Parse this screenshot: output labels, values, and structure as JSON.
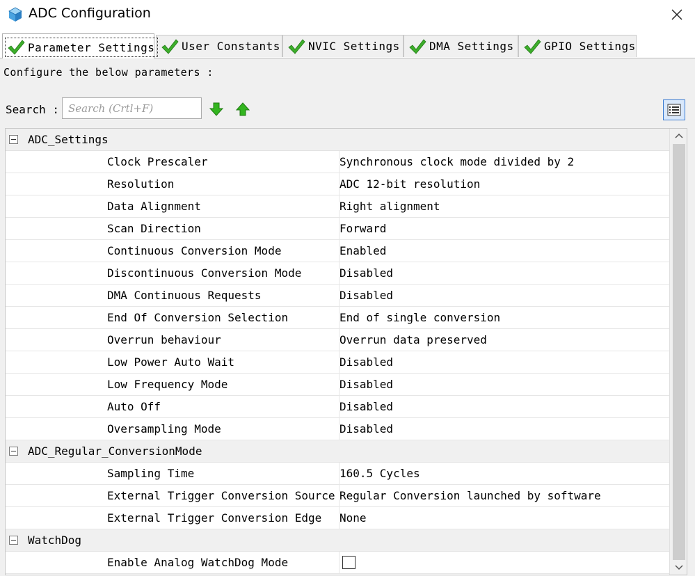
{
  "window": {
    "title": "ADC Configuration",
    "close_glyph": "✕"
  },
  "tabs": [
    {
      "label": "Parameter Settings",
      "active": true
    },
    {
      "label": "User Constants",
      "active": false
    },
    {
      "label": "NVIC Settings",
      "active": false
    },
    {
      "label": "DMA Settings",
      "active": false
    },
    {
      "label": "GPIO Settings",
      "active": false
    }
  ],
  "intro_text": "Configure the below parameters :",
  "search": {
    "label": "Search :",
    "placeholder": "Search (Crtl+F)"
  },
  "groups": {
    "adc_settings": {
      "label": "ADC_Settings",
      "params": [
        {
          "name": "Clock Prescaler",
          "value": "Synchronous clock mode divided by 2"
        },
        {
          "name": "Resolution",
          "value": "ADC 12-bit resolution"
        },
        {
          "name": "Data Alignment",
          "value": "Right alignment"
        },
        {
          "name": "Scan Direction",
          "value": "Forward"
        },
        {
          "name": "Continuous Conversion Mode",
          "value": "Enabled"
        },
        {
          "name": "Discontinuous Conversion Mode",
          "value": "Disabled"
        },
        {
          "name": "DMA Continuous Requests",
          "value": "Disabled"
        },
        {
          "name": "End Of Conversion Selection",
          "value": "End of single conversion"
        },
        {
          "name": "Overrun behaviour",
          "value": "Overrun data preserved"
        },
        {
          "name": "Low Power Auto Wait",
          "value": "Disabled"
        },
        {
          "name": "Low Frequency Mode",
          "value": "Disabled"
        },
        {
          "name": "Auto Off",
          "value": "Disabled"
        },
        {
          "name": "Oversampling Mode",
          "value": "Disabled"
        }
      ]
    },
    "adc_regular": {
      "label": "ADC_Regular_ConversionMode",
      "params": [
        {
          "name": "Sampling Time",
          "value": "160.5 Cycles"
        },
        {
          "name": "External Trigger Conversion Source",
          "value": "Regular Conversion launched by software"
        },
        {
          "name": "External Trigger Conversion Edge",
          "value": "None"
        }
      ]
    },
    "watchdog": {
      "label": "WatchDog",
      "params": [
        {
          "name": "Enable Analog WatchDog Mode",
          "checked": false
        }
      ]
    }
  },
  "colors": {
    "check_green": "#3dae2b",
    "arrow_green": "#33b51f",
    "group_bg": "#f0f0f0",
    "view_button_border": "#3b7bd1"
  }
}
